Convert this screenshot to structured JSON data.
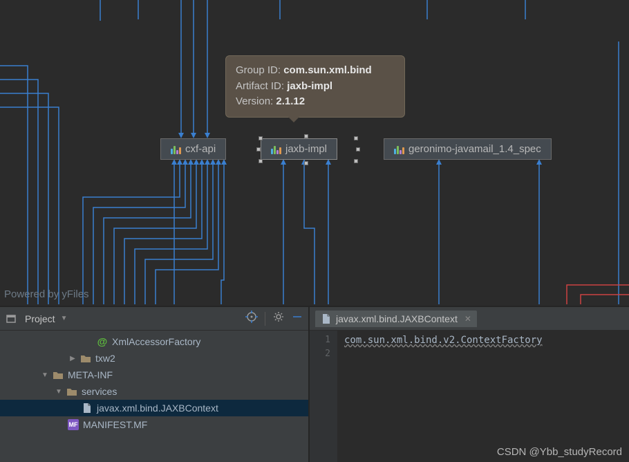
{
  "diagram": {
    "powered": "Powered by yFiles",
    "tooltip": {
      "group_label": "Group ID:",
      "group_value": "com.sun.xml.bind",
      "artifact_label": "Artifact ID:",
      "artifact_value": "jaxb-impl",
      "version_label": "Version:",
      "version_value": "2.1.12"
    },
    "nodes": {
      "cxf": "cxf-api",
      "jaxb": "jaxb-impl",
      "geronimo": "geronimo-javamail_1.4_spec"
    }
  },
  "project": {
    "title": "Project",
    "tree": {
      "xmlAccessor": "XmlAccessorFactory",
      "txw2": "txw2",
      "metaInf": "META-INF",
      "services": "services",
      "jaxbContext": "javax.xml.bind.JAXBContext",
      "manifest": "MANIFEST.MF"
    }
  },
  "editor": {
    "tab": "javax.xml.bind.JAXBContext",
    "lines": {
      "n1": "1",
      "n2": "2",
      "content1": "com.sun.xml.bind.v2.ContextFactory"
    }
  },
  "watermark": "CSDN @Ybb_studyRecord"
}
